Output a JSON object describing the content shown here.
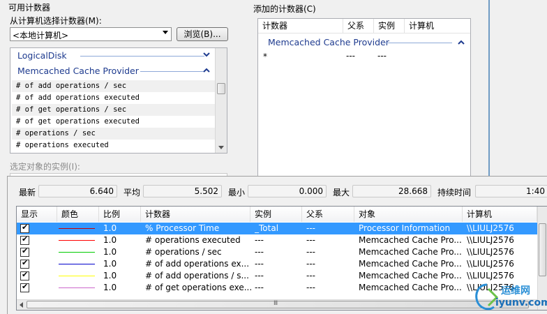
{
  "available_counters": {
    "section_title": "可用计数器",
    "select_computer_label": "从计算机选择计数器(M):",
    "computer_value": "<本地计算机>",
    "browse_label": "浏览(B)...",
    "groups": [
      {
        "name": "LogicalDisk",
        "expanded": false
      },
      {
        "name": "Memcached Cache Provider",
        "expanded": true
      }
    ],
    "counters": [
      "# of add operations / sec",
      "# of add operations executed",
      "# of get operations / sec",
      "# of get operations executed",
      "# operations / sec",
      "# operations executed"
    ],
    "instances_label": "选定对象的实例(I):"
  },
  "added_counters": {
    "section_title": "添加的计数器(C)",
    "columns": [
      "计数器",
      "父系",
      "实例",
      "计算机"
    ],
    "group": "Memcached Cache Provider",
    "row": {
      "counter": "*",
      "parent": "---",
      "instance": "---"
    }
  },
  "stats": {
    "latest_label": "最新",
    "latest_value": "6.640",
    "avg_label": "平均",
    "avg_value": "5.502",
    "min_label": "最小",
    "min_value": "0.000",
    "max_label": "最大",
    "max_value": "28.668",
    "duration_label": "持续时间",
    "duration_value": "1:40"
  },
  "grid": {
    "columns": [
      "显示",
      "颜色",
      "比例",
      "计数器",
      "实例",
      "父系",
      "对象",
      "计算机"
    ],
    "rows": [
      {
        "color": "#cc0000",
        "scale": "1.0",
        "counter": "% Processor Time",
        "instance": "_Total",
        "parent": "---",
        "object": "Processor Information",
        "computer": "\\\\LIULJ2576",
        "selected": true
      },
      {
        "color": "#ff0000",
        "scale": "1.0",
        "counter": "# operations executed",
        "instance": "---",
        "parent": "---",
        "object": "Memcached Cache Pro...",
        "computer": "\\\\LIULJ2576",
        "selected": false
      },
      {
        "color": "#00cc00",
        "scale": "1.0",
        "counter": "# operations / sec",
        "instance": "---",
        "parent": "---",
        "object": "Memcached Cache Pro...",
        "computer": "\\\\LIULJ2576",
        "selected": false
      },
      {
        "color": "#0000cc",
        "scale": "1.0",
        "counter": "# of add operations ex...",
        "instance": "---",
        "parent": "---",
        "object": "Memcached Cache Pro...",
        "computer": "\\\\LIULJ2576",
        "selected": false
      },
      {
        "color": "#ffff00",
        "scale": "1.0",
        "counter": "# of add operations / s...",
        "instance": "---",
        "parent": "---",
        "object": "Memcached Cache Pro...",
        "computer": "\\\\LIULJ2576",
        "selected": false
      },
      {
        "color": "#cc66cc",
        "scale": "1.0",
        "counter": "# of get operations exe...",
        "instance": "---",
        "parent": "---",
        "object": "Memcached Cache Pro...",
        "computer": "\\\\LIULJ2576",
        "selected": false
      }
    ]
  },
  "watermark": {
    "brand": "运维网",
    "url": "iyunv.com"
  }
}
